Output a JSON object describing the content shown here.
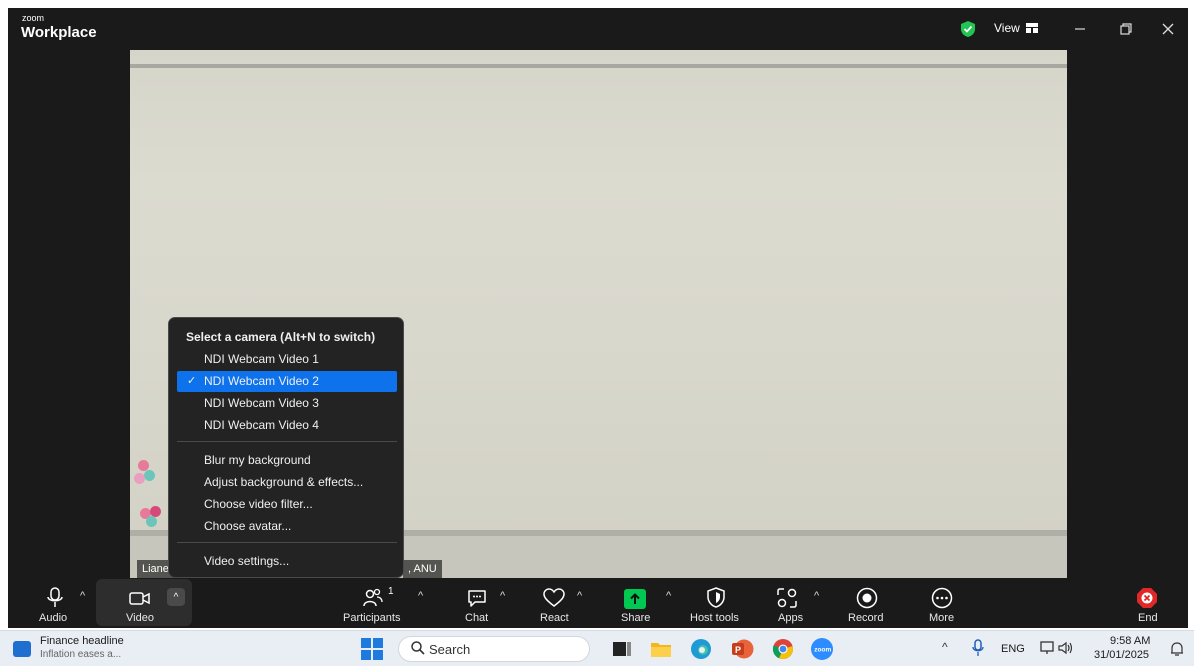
{
  "app": {
    "brand_small": "zoom",
    "brand_big": "Workplace",
    "view_label": "View"
  },
  "video": {
    "name_tag_left": "Liane .",
    "name_tag_right": ", ANU"
  },
  "camera_menu": {
    "header": "Select a camera (Alt+N to switch)",
    "cameras": [
      {
        "label": "NDI Webcam Video 1",
        "selected": false
      },
      {
        "label": "NDI Webcam Video 2",
        "selected": true
      },
      {
        "label": "NDI Webcam Video 3",
        "selected": false
      },
      {
        "label": "NDI Webcam Video 4",
        "selected": false
      }
    ],
    "check": "✓",
    "options": [
      "Blur my background",
      "Adjust background & effects...",
      "Choose video filter...",
      "Choose avatar..."
    ],
    "settings": "Video settings..."
  },
  "toolbar": {
    "audio": "Audio",
    "video": "Video",
    "participants": "Participants",
    "participants_count": "1",
    "chat": "Chat",
    "react": "React",
    "share": "Share",
    "host_tools": "Host tools",
    "apps": "Apps",
    "record": "Record",
    "more": "More",
    "end": "End",
    "share_color": "#00c853",
    "end_color": "#e02828"
  },
  "taskbar": {
    "news_title": "Finance headline",
    "news_sub": "Inflation eases a...",
    "search_placeholder": "Search",
    "lang": "ENG",
    "time": "9:58 AM",
    "date": "31/01/2025"
  }
}
